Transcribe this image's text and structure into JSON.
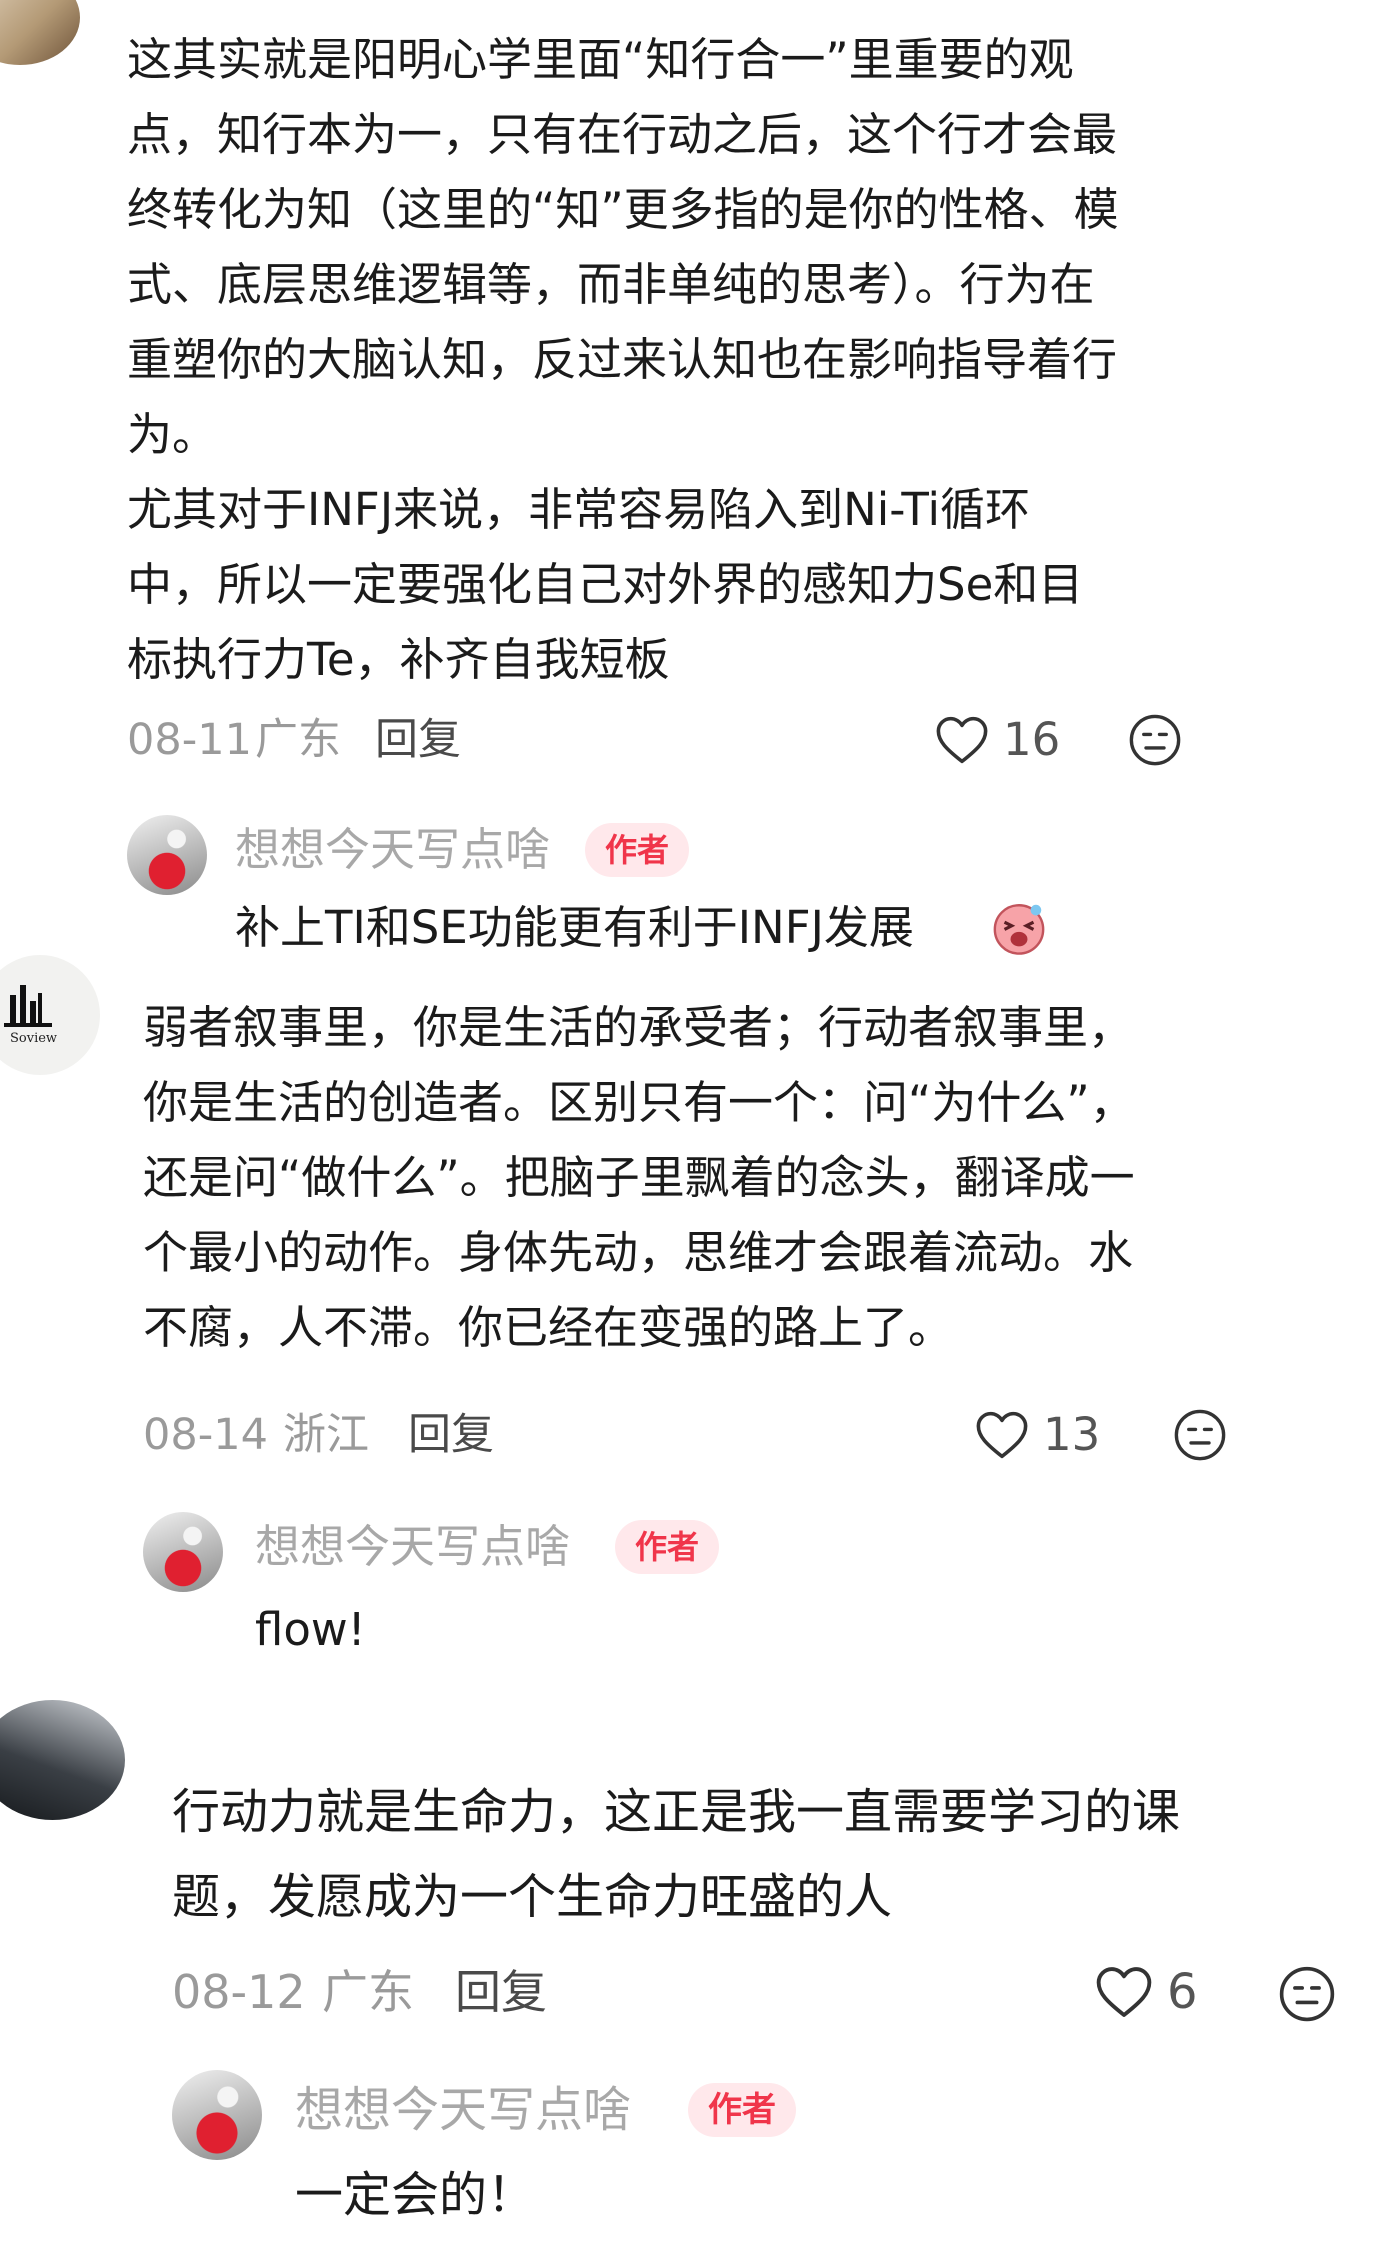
{
  "comments": [
    {
      "lines": [
        "这其实就是阳明心学里面“知行合一”里重要的观",
        "点，知行本为一，只有在行动之后，这个行才会最",
        "终转化为知（这里的“知”更多指的是你的性格、模",
        "式、底层思维逻辑等，而非单纯的思考）。行为在",
        "重塑你的大脑认知，反过来认知也在影响指导着行",
        "为。",
        "尤其对于INFJ来说，非常容易陷入到Ni-Ti循环",
        "中，所以一定要强化自己对外界的感知力Se和目",
        "标执行力Te，补齐自我短板"
      ],
      "date": "08-11",
      "location": "广东",
      "reply_label": "回复",
      "likes": "16",
      "author_reply": {
        "name": "想想今天写点啥",
        "badge": "作者",
        "text": "补上TI和SE功能更有利于INFJ发展"
      }
    },
    {
      "avatar_text": "Soview",
      "lines": [
        "弱者叙事里，你是生活的承受者；行动者叙事里，",
        "你是生活的创造者。区别只有一个：问“为什么”，",
        "还是问“做什么”。把脑子里飘着的念头，翻译成一",
        "个最小的动作。身体先动，思维才会跟着流动。水",
        "不腐，人不滞。你已经在变强的路上了。"
      ],
      "date": "08-14",
      "location": "浙江",
      "reply_label": "回复",
      "likes": "13",
      "author_reply": {
        "name": "想想今天写点啥",
        "badge": "作者",
        "text": "flow!"
      }
    },
    {
      "lines": [
        "行动力就是生命力，这正是我一直需要学习的课",
        "题，发愿成为一个生命力旺盛的人"
      ],
      "date": "08-12",
      "location": "广东",
      "reply_label": "回复",
      "likes": "6",
      "author_reply": {
        "name": "想想今天写点啥",
        "badge": "作者",
        "text": "一定会的！"
      }
    }
  ],
  "colors": {
    "badge_bg": "#ffe8eb",
    "badge_text": "#f0354a",
    "meta_gray": "#9a9a9a"
  },
  "icons": {
    "like": "heart-outline-icon",
    "dislike": "neutral-face-icon"
  }
}
